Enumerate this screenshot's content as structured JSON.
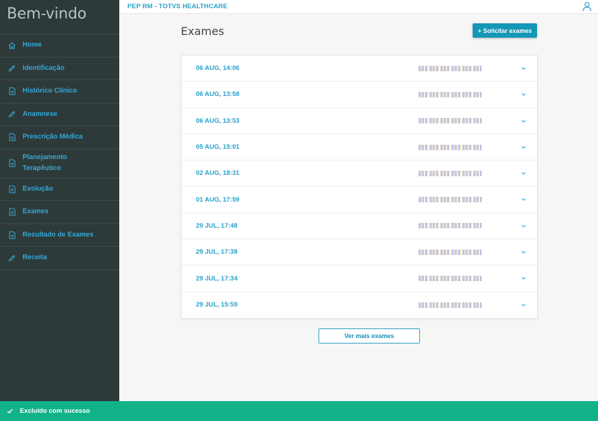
{
  "sidebar": {
    "title": "Bem-vindo",
    "items": [
      {
        "label": "Home",
        "icon": "home-icon"
      },
      {
        "label": "Identificação",
        "icon": "pencil-icon"
      },
      {
        "label": "Histórico Clínico",
        "icon": "document-icon"
      },
      {
        "label": "Anamnese",
        "icon": "pencil-icon"
      },
      {
        "label": "Prescrição Médica",
        "icon": "document-icon"
      },
      {
        "label": "Planejamento Terapêutico",
        "icon": "document-icon"
      },
      {
        "label": "Evolução",
        "icon": "document-icon"
      },
      {
        "label": "Exames",
        "icon": "document-icon"
      },
      {
        "label": "Resultado de Exames",
        "icon": "document-icon"
      },
      {
        "label": "Receita",
        "icon": "pencil-icon"
      }
    ]
  },
  "header": {
    "app_name": "PEP RM - TOTVS HEALTHCARE",
    "user_icon": "user-icon"
  },
  "main": {
    "title": "Exames",
    "request_button": "+ Solicitar exames",
    "more_button": "Ver mais exames",
    "exams": [
      {
        "date": "06 AUG, 14:06"
      },
      {
        "date": "06 AUG, 13:58"
      },
      {
        "date": "06 AUG, 13:53"
      },
      {
        "date": "05 AUG, 15:01"
      },
      {
        "date": "02 AUG, 18:31"
      },
      {
        "date": "01 AUG, 17:59"
      },
      {
        "date": "29 JUL, 17:48"
      },
      {
        "date": "29 JUL, 17:38"
      },
      {
        "date": "29 JUL, 17:34"
      },
      {
        "date": "29 JUL, 15:59"
      }
    ]
  },
  "toast": {
    "message": "Excluído com sucesso",
    "icon": "check-icon"
  },
  "colors": {
    "sidebar_bg": "#2d3a39",
    "accent": "#1496b7",
    "link": "#2ba0c8",
    "toast_bg": "#13b38a"
  }
}
